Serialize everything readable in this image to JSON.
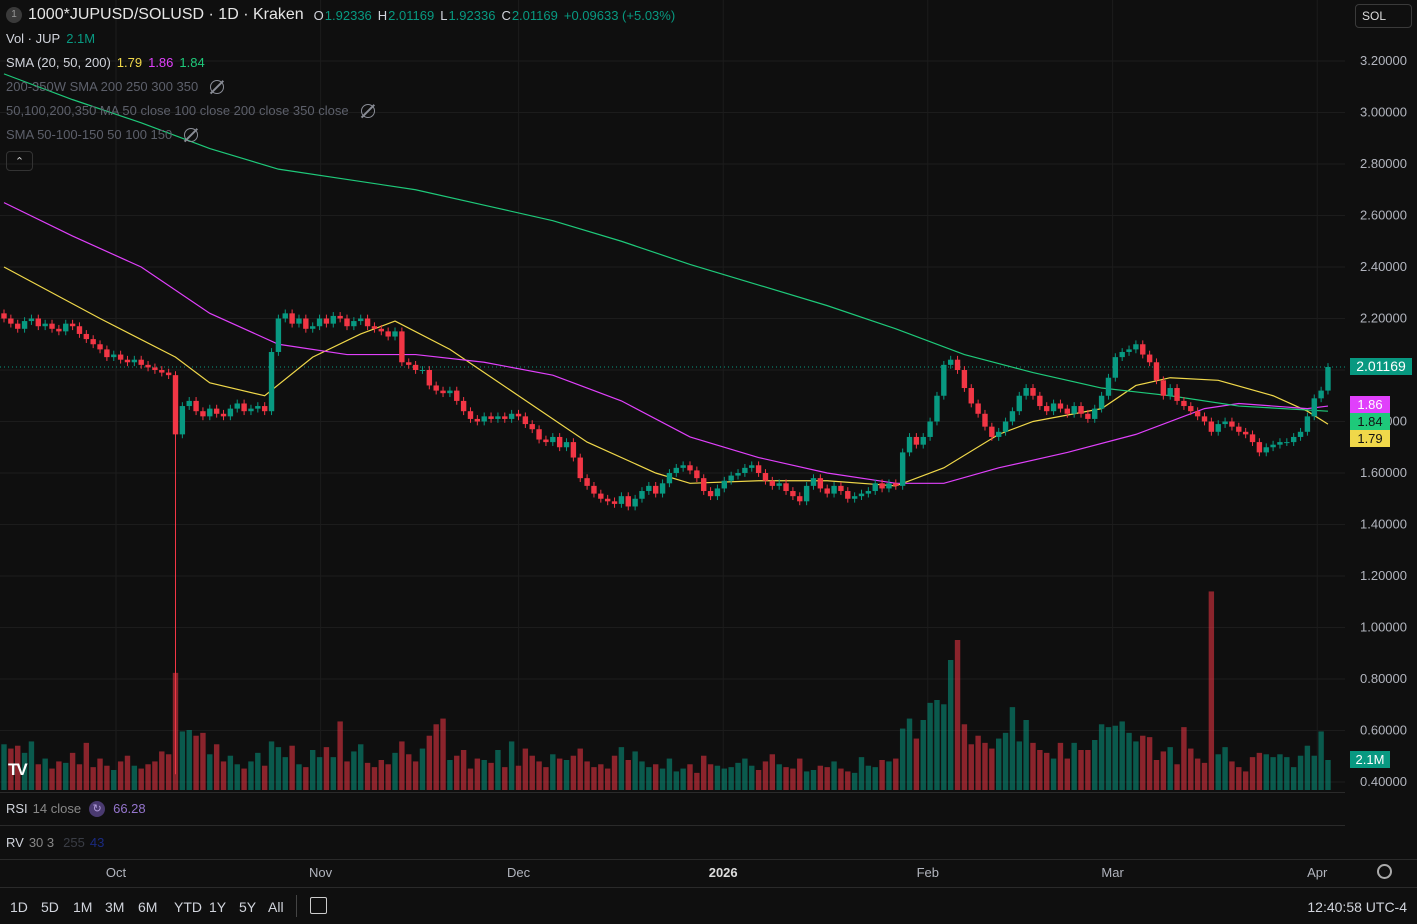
{
  "header": {
    "badge": "1",
    "symbol": "1000*JUPUSD/SOLUSD · 1D · Kraken",
    "o_label": "O",
    "o": "1.92336",
    "h_label": "H",
    "h": "2.01169",
    "l_label": "L",
    "l": "1.92336",
    "c_label": "C",
    "c": "2.01169",
    "change": "+0.09633 (+5.03%)"
  },
  "currency_button": "SOL",
  "indicators": {
    "vol": {
      "label": "Vol · JUP",
      "value": "2.1M"
    },
    "sma": {
      "label": "SMA (20, 50, 200)",
      "v20": "1.79",
      "v50": "1.86",
      "v200": "1.84"
    },
    "hidden1": "200-350W SMA 200 250 300 350",
    "hidden2": "50,100,200,350 MA 50 close 100 close 200 close 350 close",
    "hidden3": "SMA 50-100-150 50 100 150",
    "rsi": {
      "label": "RSI",
      "params": "14 close",
      "value": "66.28"
    },
    "rv": {
      "label": "RV",
      "params": "30 3",
      "v1": "255",
      "v2": "43"
    }
  },
  "badges": {
    "price": "2.01169",
    "sma50": "1.86",
    "sma200": "1.84",
    "sma20": "1.79",
    "volume": "2.1M"
  },
  "colors": {
    "up": "#089981",
    "down": "#f23645",
    "sma20": "#f0d84a",
    "sma50": "#e040fb",
    "sma200": "#1ec97a",
    "bg": "#0f0f0f"
  },
  "time_labels": [
    {
      "t": "Oct",
      "day": 17
    },
    {
      "t": "Nov",
      "day": 48
    },
    {
      "t": "Dec",
      "day": 78
    },
    {
      "t": "2026",
      "day": 109
    },
    {
      "t": "Feb",
      "day": 140
    },
    {
      "t": "Mar",
      "day": 168
    },
    {
      "t": "Apr",
      "day": 199
    }
  ],
  "ranges": [
    "1D",
    "5D",
    "1M",
    "3M",
    "6M",
    "YTD",
    "1Y",
    "5Y",
    "All"
  ],
  "clock": "12:40:58 UTC-4",
  "chart_data": {
    "type": "candlestick",
    "title": "1000*JUPUSD/SOLUSD 1D",
    "ylim": [
      0.4,
      3.2
    ],
    "yticks": [
      "3.20000",
      "3.00000",
      "2.80000",
      "2.60000",
      "2.40000",
      "2.20000",
      "2.00000",
      "1.80000",
      "1.60000",
      "1.40000",
      "1.20000",
      "1.00000",
      "0.80000",
      "0.60000",
      "0.40000"
    ],
    "last_price": 2.01169,
    "wick_low": {
      "index": 25,
      "value": 0.43
    },
    "closes": [
      2.2,
      2.18,
      2.16,
      2.19,
      2.2,
      2.17,
      2.18,
      2.16,
      2.15,
      2.18,
      2.17,
      2.14,
      2.12,
      2.1,
      2.08,
      2.05,
      2.06,
      2.04,
      2.03,
      2.04,
      2.02,
      2.01,
      2.0,
      1.99,
      1.98,
      1.75,
      1.86,
      1.88,
      1.84,
      1.82,
      1.85,
      1.83,
      1.82,
      1.85,
      1.87,
      1.84,
      1.85,
      1.86,
      1.84,
      2.07,
      2.2,
      2.22,
      2.18,
      2.2,
      2.16,
      2.17,
      2.2,
      2.18,
      2.21,
      2.2,
      2.17,
      2.19,
      2.2,
      2.17,
      2.16,
      2.15,
      2.13,
      2.15,
      2.03,
      2.02,
      2.0,
      2.0,
      1.94,
      1.92,
      1.91,
      1.92,
      1.88,
      1.84,
      1.81,
      1.8,
      1.82,
      1.81,
      1.82,
      1.81,
      1.83,
      1.82,
      1.79,
      1.77,
      1.73,
      1.72,
      1.74,
      1.7,
      1.72,
      1.66,
      1.58,
      1.55,
      1.52,
      1.5,
      1.49,
      1.48,
      1.51,
      1.47,
      1.5,
      1.53,
      1.55,
      1.52,
      1.56,
      1.6,
      1.62,
      1.63,
      1.61,
      1.58,
      1.53,
      1.51,
      1.54,
      1.57,
      1.59,
      1.6,
      1.62,
      1.63,
      1.6,
      1.57,
      1.55,
      1.56,
      1.53,
      1.51,
      1.49,
      1.55,
      1.58,
      1.54,
      1.52,
      1.55,
      1.53,
      1.5,
      1.51,
      1.52,
      1.53,
      1.56,
      1.54,
      1.56,
      1.55,
      1.68,
      1.74,
      1.71,
      1.74,
      1.8,
      1.9,
      2.02,
      2.04,
      2.0,
      1.93,
      1.87,
      1.83,
      1.78,
      1.74,
      1.76,
      1.8,
      1.84,
      1.9,
      1.93,
      1.9,
      1.86,
      1.84,
      1.87,
      1.85,
      1.83,
      1.86,
      1.83,
      1.81,
      1.85,
      1.9,
      1.97,
      2.05,
      2.07,
      2.08,
      2.1,
      2.06,
      2.03,
      1.96,
      1.9,
      1.93,
      1.88,
      1.86,
      1.84,
      1.82,
      1.8,
      1.76,
      1.79,
      1.8,
      1.78,
      1.76,
      1.75,
      1.72,
      1.68,
      1.7,
      1.71,
      1.72,
      1.72,
      1.74,
      1.76,
      1.82,
      1.89,
      1.92,
      2.01169
    ],
    "volume_m": [
      3.2,
      2.9,
      3.1,
      2.6,
      3.4,
      1.8,
      2.2,
      1.5,
      2.0,
      1.9,
      2.6,
      1.8,
      3.3,
      1.6,
      2.2,
      1.7,
      1.4,
      2.0,
      2.4,
      1.7,
      1.5,
      1.8,
      2.0,
      2.7,
      2.5,
      8.2,
      4.1,
      4.2,
      3.8,
      4.0,
      2.5,
      3.2,
      2.0,
      2.4,
      1.8,
      1.5,
      2.0,
      2.6,
      1.7,
      3.4,
      3.0,
      2.3,
      3.1,
      1.8,
      1.6,
      2.8,
      2.3,
      3.0,
      2.3,
      4.8,
      2.0,
      2.7,
      3.2,
      1.9,
      1.6,
      2.1,
      1.8,
      2.6,
      3.4,
      2.5,
      2.0,
      2.9,
      3.8,
      4.6,
      5.0,
      2.1,
      2.4,
      2.8,
      1.5,
      2.2,
      2.1,
      1.9,
      2.8,
      1.6,
      3.4,
      1.7,
      2.9,
      2.4,
      2.0,
      1.6,
      2.5,
      2.2,
      2.1,
      2.4,
      2.9,
      2.0,
      1.6,
      1.8,
      1.5,
      2.4,
      3.0,
      2.1,
      2.7,
      2.0,
      1.6,
      1.8,
      1.5,
      2.2,
      1.3,
      1.5,
      1.8,
      1.2,
      2.4,
      1.8,
      1.7,
      1.5,
      1.6,
      1.9,
      2.2,
      1.7,
      1.4,
      2.0,
      2.5,
      1.8,
      1.6,
      1.5,
      2.2,
      1.3,
      1.4,
      1.7,
      1.6,
      2.0,
      1.5,
      1.3,
      1.2,
      2.3,
      1.7,
      1.6,
      2.1,
      2.0,
      2.2,
      4.3,
      5.0,
      3.6,
      4.9,
      6.1,
      6.3,
      6.0,
      9.1,
      10.5,
      4.6,
      3.2,
      3.8,
      3.3,
      2.9,
      3.6,
      4.0,
      5.8,
      3.4,
      4.9,
      3.3,
      2.8,
      2.6,
      2.2,
      3.3,
      2.2,
      3.3,
      2.8,
      2.8,
      3.5,
      4.6,
      4.4,
      4.5,
      4.8,
      4.0,
      3.4,
      3.8,
      3.7,
      2.1,
      2.7,
      3.0,
      1.8,
      4.4,
      2.9,
      2.2,
      1.9,
      13.9,
      2.5,
      3.0,
      2.0,
      1.6,
      1.3,
      2.3,
      2.6,
      2.5,
      2.3,
      2.5,
      2.3,
      1.6,
      2.4,
      3.1,
      2.4,
      4.1,
      2.1
    ],
    "series": [
      {
        "name": "SMA 20",
        "color": "#f0d84a",
        "points": [
          [
            0,
            2.4
          ],
          [
            14,
            2.2
          ],
          [
            25,
            2.05
          ],
          [
            30,
            1.95
          ],
          [
            38,
            1.9
          ],
          [
            45,
            2.05
          ],
          [
            52,
            2.14
          ],
          [
            57,
            2.19
          ],
          [
            65,
            2.08
          ],
          [
            75,
            1.9
          ],
          [
            85,
            1.72
          ],
          [
            95,
            1.6
          ],
          [
            100,
            1.56
          ],
          [
            110,
            1.57
          ],
          [
            120,
            1.57
          ],
          [
            130,
            1.55
          ],
          [
            137,
            1.62
          ],
          [
            145,
            1.75
          ],
          [
            150,
            1.8
          ],
          [
            160,
            1.85
          ],
          [
            165,
            1.94
          ],
          [
            170,
            1.97
          ],
          [
            177,
            1.96
          ],
          [
            185,
            1.9
          ],
          [
            190,
            1.84
          ],
          [
            193,
            1.79
          ]
        ]
      },
      {
        "name": "SMA 50",
        "color": "#e040fb",
        "points": [
          [
            0,
            2.65
          ],
          [
            10,
            2.52
          ],
          [
            20,
            2.4
          ],
          [
            30,
            2.22
          ],
          [
            40,
            2.1
          ],
          [
            50,
            2.06
          ],
          [
            60,
            2.06
          ],
          [
            70,
            2.03
          ],
          [
            80,
            1.98
          ],
          [
            90,
            1.88
          ],
          [
            100,
            1.74
          ],
          [
            110,
            1.66
          ],
          [
            120,
            1.6
          ],
          [
            130,
            1.56
          ],
          [
            137,
            1.56
          ],
          [
            145,
            1.62
          ],
          [
            155,
            1.68
          ],
          [
            165,
            1.75
          ],
          [
            175,
            1.85
          ],
          [
            180,
            1.87
          ],
          [
            190,
            1.85
          ],
          [
            193,
            1.86
          ]
        ]
      },
      {
        "name": "SMA 200",
        "color": "#1ec97a",
        "points": [
          [
            0,
            3.15
          ],
          [
            10,
            3.05
          ],
          [
            20,
            2.96
          ],
          [
            30,
            2.86
          ],
          [
            40,
            2.78
          ],
          [
            50,
            2.74
          ],
          [
            60,
            2.7
          ],
          [
            70,
            2.64
          ],
          [
            80,
            2.58
          ],
          [
            90,
            2.5
          ],
          [
            100,
            2.41
          ],
          [
            110,
            2.33
          ],
          [
            120,
            2.25
          ],
          [
            130,
            2.16
          ],
          [
            140,
            2.06
          ],
          [
            150,
            1.99
          ],
          [
            160,
            1.93
          ],
          [
            170,
            1.9
          ],
          [
            180,
            1.86
          ],
          [
            193,
            1.84
          ]
        ]
      }
    ]
  }
}
